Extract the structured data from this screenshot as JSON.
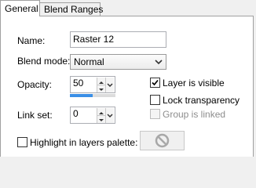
{
  "tabs": [
    {
      "label": "General",
      "active": true
    },
    {
      "label": "Blend Ranges",
      "active": false
    }
  ],
  "fields": {
    "name": {
      "label": "Name:",
      "value": "Raster 12"
    },
    "blend_mode": {
      "label": "Blend mode:",
      "value": "Normal"
    },
    "opacity": {
      "label": "Opacity:",
      "value": "50",
      "slider_level": 0.5
    },
    "link_set": {
      "label": "Link set:",
      "value": "0"
    }
  },
  "checkboxes": {
    "layer_visible": {
      "label": "Layer is visible",
      "checked": true
    },
    "lock_transparency": {
      "label": "Lock transparency",
      "checked": false
    },
    "group_linked": {
      "label": "Group is linked",
      "checked": false,
      "disabled": true
    },
    "highlight": {
      "label": "Highlight in layers palette:",
      "checked": false
    }
  },
  "icons": {
    "no_color_swatch": "no-symbol-icon"
  },
  "colors": {
    "slider_fill": "#3a8ee6",
    "panel_bg": "#ffffff",
    "window_bg": "#f0f0f0"
  }
}
